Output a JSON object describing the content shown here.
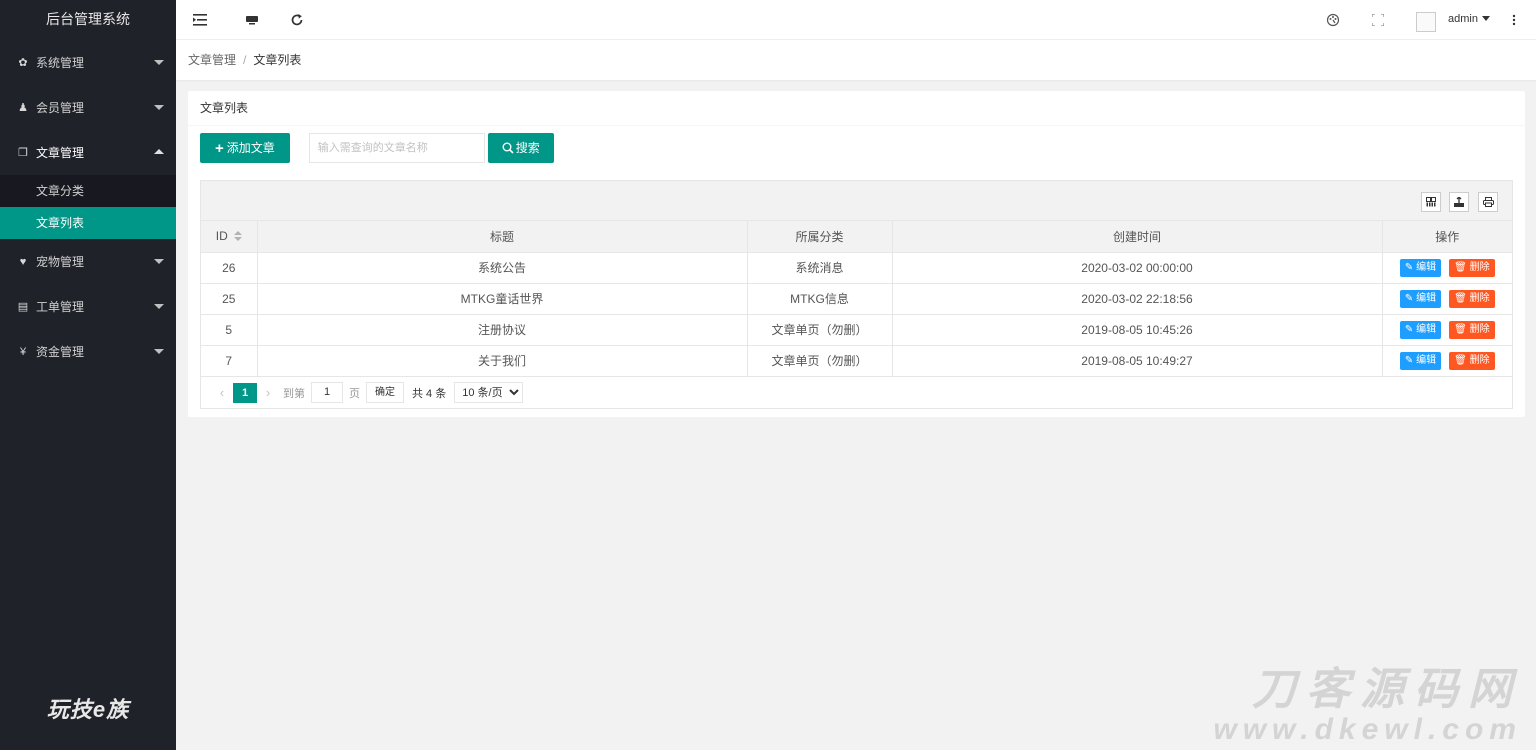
{
  "app": {
    "title": "后台管理系统",
    "brand": "玩技e族"
  },
  "sidebar": {
    "items": [
      {
        "label": "系统管理",
        "icon": "gear-icon",
        "glyph": "✿"
      },
      {
        "label": "会员管理",
        "icon": "users-icon",
        "glyph": "👥"
      },
      {
        "label": "文章管理",
        "icon": "copy-icon",
        "glyph": "❐"
      },
      {
        "label": "宠物管理",
        "icon": "heart-icon",
        "glyph": "♥"
      },
      {
        "label": "工单管理",
        "icon": "file-icon",
        "glyph": "▤"
      },
      {
        "label": "资金管理",
        "icon": "yen-icon",
        "glyph": "¥"
      }
    ],
    "sub_items": [
      {
        "label": "文章分类"
      },
      {
        "label": "文章列表"
      }
    ]
  },
  "topbar": {
    "user": "admin"
  },
  "breadcrumb": {
    "parent": "文章管理",
    "current": "文章列表"
  },
  "card": {
    "title": "文章列表"
  },
  "toolbar": {
    "add_label": "添加文章",
    "search_placeholder": "输入需查询的文章名称",
    "search_label": "搜索"
  },
  "table": {
    "headers": [
      "ID",
      "标题",
      "所属分类",
      "创建时间",
      "操作"
    ],
    "rows": [
      {
        "id": "26",
        "title": "系统公告",
        "category": "系统消息",
        "created": "2020-03-02 00:00:00"
      },
      {
        "id": "25",
        "title": "MTKG童话世界",
        "category": "MTKG信息",
        "created": "2020-03-02 22:18:56"
      },
      {
        "id": "5",
        "title": "注册协议",
        "category": "文章单页（勿删）",
        "created": "2019-08-05 10:45:26"
      },
      {
        "id": "7",
        "title": "关于我们",
        "category": "文章单页（勿删）",
        "created": "2019-08-05 10:49:27"
      }
    ],
    "edit_label": "编辑",
    "delete_label": "删除"
  },
  "pager": {
    "current": "1",
    "goto_label": "到第",
    "goto_value": "1",
    "page_unit": "页",
    "confirm": "确定",
    "total": "共 4 条",
    "page_size": "10 条/页"
  },
  "watermark": {
    "line1": "刀客源码网",
    "line2": "www.dkewl.com"
  },
  "colors": {
    "primary": "#009688",
    "sidebar_bg": "#20222a",
    "edit": "#1e9fff",
    "delete": "#ff5722"
  }
}
